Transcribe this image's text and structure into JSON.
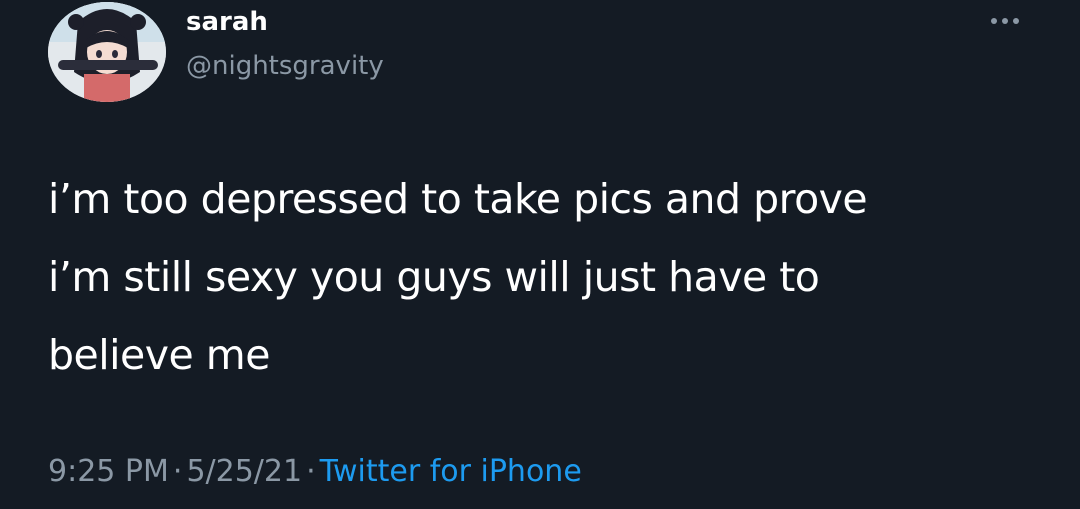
{
  "user": {
    "display_name": "sarah",
    "handle": "@nightsgravity"
  },
  "tweet": {
    "text_lines": [
      "i’m too depressed to take pics and prove",
      "i’m still sexy you guys will just have to",
      "believe me"
    ],
    "time": "9:25 PM",
    "date": "5/25/21",
    "separator": "·",
    "source": "Twitter for iPhone"
  },
  "icons": {
    "more": "more-horizontal-icon",
    "avatar": "profile-avatar"
  },
  "colors": {
    "background": "#141b24",
    "text": "#ffffff",
    "muted": "#8b98a5",
    "link": "#1d9bf0"
  }
}
